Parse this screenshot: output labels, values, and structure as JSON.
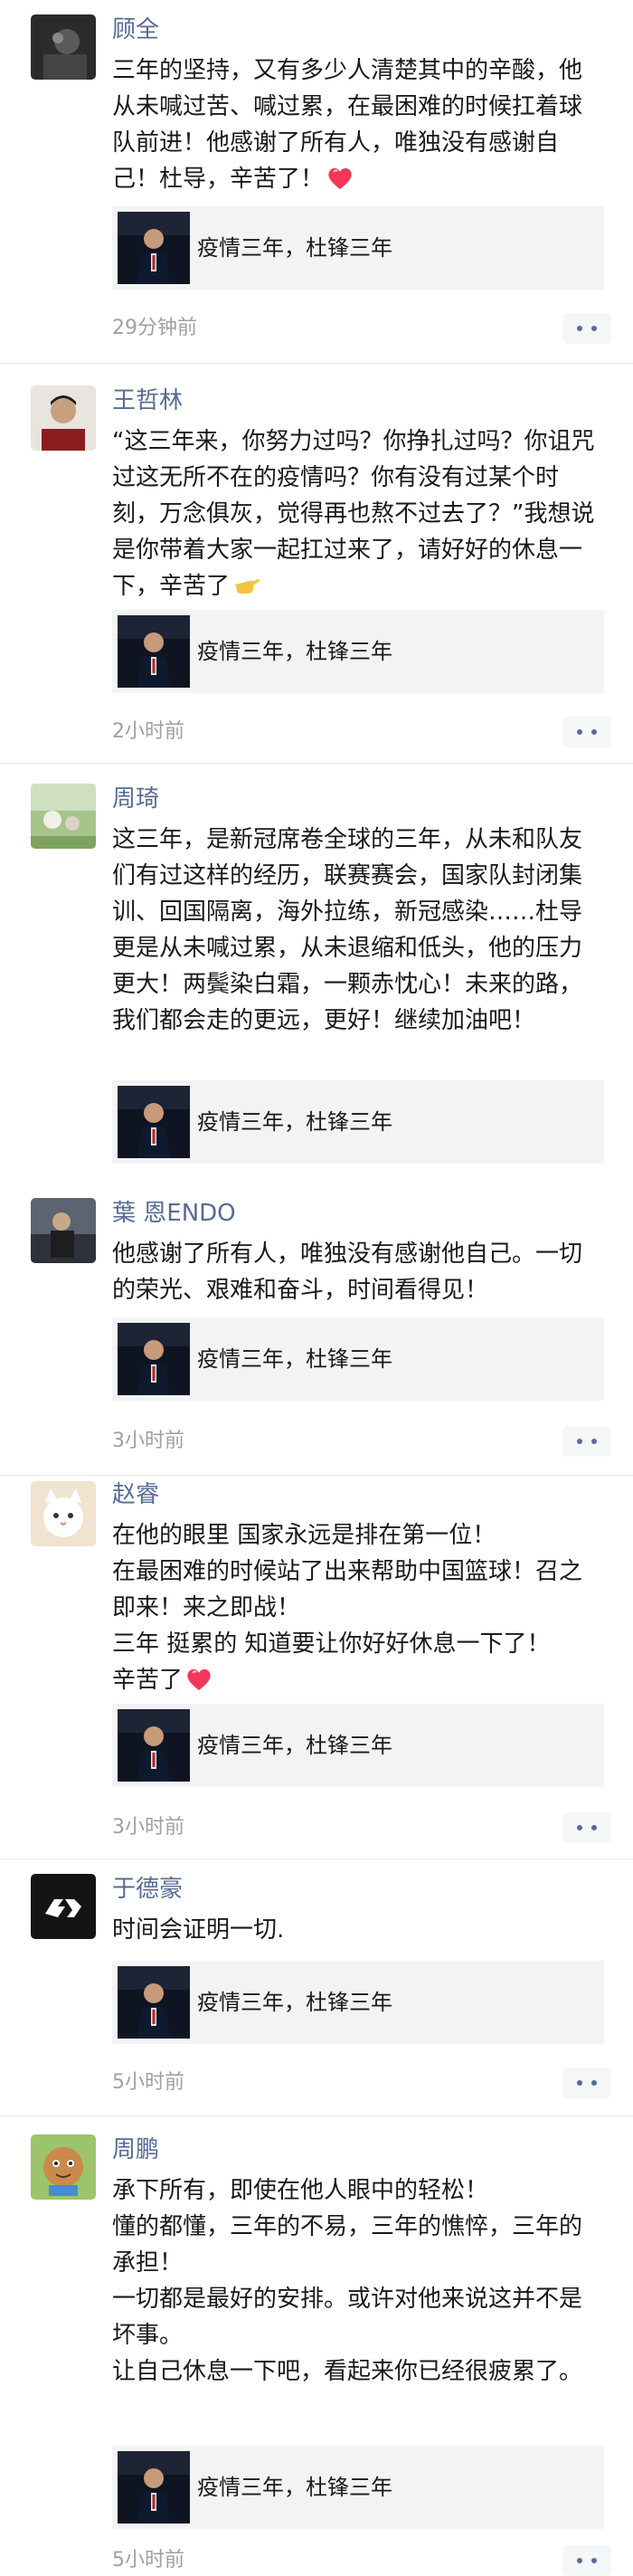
{
  "posts": [
    {
      "author": "顾全",
      "text": "三年的坚持，又有多少人清楚其中的辛酸，他从未喊过苦、喊过累，在最困难的时候扛着球队前进！他感谢了所有人，唯独没有感谢自己！杜导，辛苦了！",
      "emoji": "heart-icon",
      "share_title": "疫情三年，杜锋三年",
      "time": "29分钟前"
    },
    {
      "author": "王哲林",
      "text": "“这三年来，你努力过吗？你挣扎过吗？你诅咒过这无所不在的疫情吗？你有没有过某个时刻，万念俱灰，觉得再也熬不过去了？”我想说是你带着大家一起扛过来了，请好好的休息一下，辛苦了",
      "emoji": "pointing-hand-icon",
      "share_title": "疫情三年，杜锋三年",
      "time": "2小时前"
    },
    {
      "author": "周琦",
      "text": "这三年，是新冠席卷全球的三年，从未和队友们有过这样的经历，联赛赛会，国家队封闭集训、回国隔离，海外拉练，新冠感染……杜导更是从未喊过累，从未退缩和低头，他的压力更大！两鬓染白霜，一颗赤忱心！未来的路，我们都会走的更远，更好！继续加油吧！",
      "share_title": "疫情三年，杜锋三年",
      "time": ""
    },
    {
      "author": "葉 恩ENDO",
      "text": "他感谢了所有人，唯独没有感谢他自己。一切的荣光、艰难和奋斗，时间看得见！",
      "share_title": "疫情三年，杜锋三年",
      "time": "3小时前"
    },
    {
      "author": "赵睿",
      "text": "在他的眼里 国家永远是排在第一位！\n在最困难的时候站了出来帮助中国篮球！召之即来！来之即战！\n三年 挺累的 知道要让你好好休息一下了！\n辛苦了",
      "emoji": "heart-icon",
      "share_title": "疫情三年，杜锋三年",
      "time": "3小时前"
    },
    {
      "author": "于德豪",
      "text": "时间会证明一切.",
      "share_title": "疫情三年，杜锋三年",
      "time": "5小时前"
    },
    {
      "author": "周鹏",
      "text": "承下所有，即使在他人眼中的轻松！\n懂的都懂，三年的不易，三年的憔悴，三年的承担！\n一切都是最好的安排。或许对他来说这并不是坏事。\n让自己休息一下吧，看起来你已经很疲累了。",
      "share_title": "疫情三年，杜锋三年",
      "time": "5小时前"
    }
  ],
  "colors": {
    "author": "#576b95",
    "text": "#1a1a1a",
    "time": "#a0a0a0",
    "share_bg": "#f3f3f5",
    "divider": "#e9e9e9"
  }
}
